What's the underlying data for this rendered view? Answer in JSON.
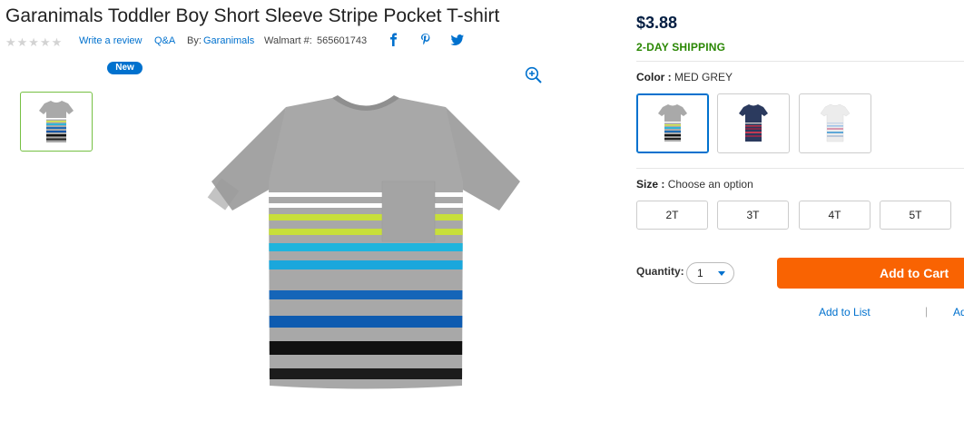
{
  "product": {
    "title": "Garanimals Toddler Boy Short Sleeve Stripe Pocket T-shirt",
    "rating_stars": "★★★★★",
    "write_review": "Write a review",
    "qa": "Q&A",
    "by_label": "By:",
    "brand": "Garanimals",
    "walmart_label": "Walmart #:",
    "walmart_number": "565601743",
    "badge": "New"
  },
  "buybox": {
    "price": "$3.88",
    "shipping": "2-DAY SHIPPING",
    "color_label": "Color :",
    "color_value": "MED GREY",
    "size_label": "Size :",
    "size_value": "Choose an option",
    "sizes": [
      "2T",
      "3T",
      "4T",
      "5T"
    ],
    "quantity_label": "Quantity:",
    "quantity_value": "1",
    "add_to_cart": "Add to Cart",
    "add_to_list": "Add to List",
    "divider": "|",
    "truncated_link": "Ad"
  },
  "swatches": [
    {
      "name": "med-grey",
      "selected": true
    },
    {
      "name": "navy",
      "selected": false
    },
    {
      "name": "white",
      "selected": false
    }
  ],
  "colors": {
    "brand_blue": "#0071ce",
    "cart_orange": "#f96302",
    "shipping_green": "#2a8703",
    "price_navy": "#041e42"
  },
  "icons": [
    "facebook-icon",
    "pinterest-icon",
    "twitter-icon",
    "zoom-icon"
  ]
}
